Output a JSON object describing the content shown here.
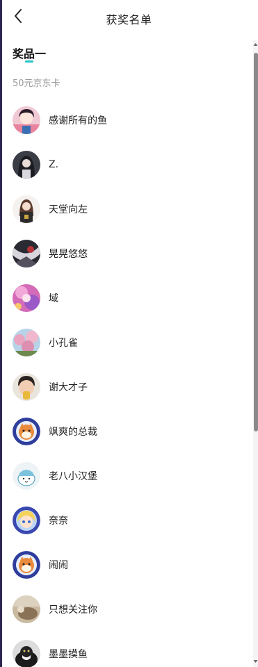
{
  "header": {
    "title": "获奖名单",
    "back_icon": "chevron-left-icon"
  },
  "section": {
    "title": "奖品一",
    "accent_color": "#26c2c9",
    "prize": "50元京东卡"
  },
  "winners": [
    {
      "name": "感谢所有的鱼",
      "avatar": "anime-girl-peace-sign"
    },
    {
      "name": "Z.",
      "avatar": "dark-haired-anime-character"
    },
    {
      "name": "天堂向左",
      "avatar": "anime-girl-dark-outfit"
    },
    {
      "name": "晃晃悠悠",
      "avatar": "dark-illustration"
    },
    {
      "name": "域",
      "avatar": "pink-purple-anime"
    },
    {
      "name": "小孔雀",
      "avatar": "pink-blossom-photo"
    },
    {
      "name": "谢大才子",
      "avatar": "child-photo"
    },
    {
      "name": "飒爽的总裁",
      "avatar": "shiba-dog-astronaut"
    },
    {
      "name": "老八小汉堡",
      "avatar": "white-cartoon-character"
    },
    {
      "name": "奈奈",
      "avatar": "blonde-anime-chibi"
    },
    {
      "name": "闹闹",
      "avatar": "shiba-dog-astronaut"
    },
    {
      "name": "只想关注你",
      "avatar": "sepia-photo"
    },
    {
      "name": "墨墨摸鱼",
      "avatar": "black-white-cat"
    }
  ]
}
